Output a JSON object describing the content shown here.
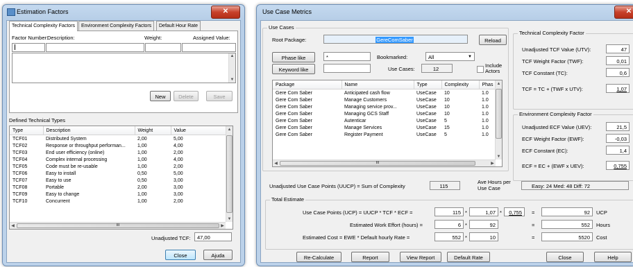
{
  "est": {
    "title": "Estimation Factors",
    "tabs": [
      "Technical Complexity Factors",
      "Environment Complexity Factors",
      "Default Hour Rate"
    ],
    "headers": {
      "number": "Factor Number:",
      "description": "Description:",
      "weight": "Weight:",
      "assigned": "Assigned Value:"
    },
    "buttons": {
      "new": "New",
      "delete": "Delete",
      "save": "Save"
    },
    "defined_label": "Defined Technical Types",
    "columns": [
      "Type",
      "Description",
      "Weight",
      "Value"
    ],
    "rows": [
      [
        "TCF01",
        "Distributed System",
        "2,00",
        "5,00"
      ],
      [
        "TCF02",
        "Response or throughput performan...",
        "1,00",
        "4,00"
      ],
      [
        "TCF03",
        "End user efficiency (online)",
        "1,00",
        "2,00"
      ],
      [
        "TCF04",
        "Complex internal processing",
        "1,00",
        "4,00"
      ],
      [
        "TCF05",
        "Code must be re-usable",
        "1,00",
        "2,00"
      ],
      [
        "TCF06",
        "Easy to install",
        "0,50",
        "5,00"
      ],
      [
        "TCF07",
        "Easy to use",
        "0,50",
        "3,00"
      ],
      [
        "TCF08",
        "Portable",
        "2,00",
        "3,00"
      ],
      [
        "TCF09",
        "Easy to change",
        "1,00",
        "3,00"
      ],
      [
        "TCF10",
        "Concurrent",
        "1,00",
        "2,00"
      ]
    ],
    "hscroll_mark": "III",
    "unadjusted_label": "Unadjusted TCF:",
    "unadjusted_value": "47,00",
    "close": "Close",
    "help": "Ajuda"
  },
  "ucm": {
    "title": "Use Case Metrics",
    "use_cases": {
      "group": "Use Cases",
      "root_label": "Root Package:",
      "root_value": "GereComSaber",
      "reload": "Reload",
      "phase_btn": "Phase like",
      "phase_value": "*",
      "bookmarked_label": "Bookmarked:",
      "bookmarked_value": "All",
      "keyword_btn": "Keyword like",
      "keyword_value": "",
      "usecases_label": "Use Cases:",
      "usecases_count": "12",
      "include_actors": "Include Actors"
    },
    "columns": [
      "Package",
      "Name",
      "Type",
      "Complexity",
      "Phas"
    ],
    "rows": [
      [
        "Gere Com Saber",
        "Anticipated cash flow",
        "UseCase",
        "10",
        "1.0"
      ],
      [
        "Gere Com Saber",
        "Manage Customers",
        "UseCase",
        "10",
        "1.0"
      ],
      [
        "Gere Com Saber",
        "Managing service prov...",
        "UseCase",
        "10",
        "1.0"
      ],
      [
        "Gere Com Saber",
        "Managing GCS Staff",
        "UseCase",
        "10",
        "1.0"
      ],
      [
        "Gere Com Saber",
        "Autenticar",
        "UseCase",
        "5",
        "1.0"
      ],
      [
        "Gere Com Saber",
        "Manage Services",
        "UseCase",
        "15",
        "1.0"
      ],
      [
        "Gere Com Saber",
        "Register Payment",
        "UseCase",
        "5",
        "1.0"
      ]
    ],
    "hscroll_mark": "III",
    "tcf": {
      "group": "Technical Complexity Factor",
      "utv_label": "Unadjusted TCF Value (UTV):",
      "utv": "47",
      "twf_label": "TCF Weight Factor (TWF):",
      "twf": "0,01",
      "tc_label": "TCF Constant (TC):",
      "tc": "0,6",
      "formula": "TCF = TC + (TWF x UTV):",
      "result": "1,07"
    },
    "ecf": {
      "group": "Environment Complexity Factor",
      "uev_label": "Unadjusted ECF Value (UEV):",
      "uev": "21,5",
      "ewf_label": "ECF Weight Factor (EWF):",
      "ewf": "-0,03",
      "ec_label": "ECF Constant (EC):",
      "ec": "1,4",
      "formula": "ECF = EC + (EWF x UEV):",
      "result": "0,755"
    },
    "uucp_label": "Unadjusted Use Case Points (UUCP) = Sum of Complexity",
    "uucp_value": "115",
    "ave_label": "Ave Hours per Use Case",
    "ave_values": "Easy: 24   Med: 48   Diff: 72",
    "total": {
      "group": "Total Estimate",
      "ucp_label": "Use Case Points (UCP) = UUCP * TCF * ECF =",
      "ucp_a": "115",
      "ucp_b": "1,07",
      "ucp_c": "0,755",
      "ucp_result": "92",
      "ucp_unit": "UCP",
      "ewe_label": "Estimated Work Effort (hours) =",
      "ewe_a": "6",
      "ewe_b": "92",
      "ewe_result": "552",
      "ewe_unit": "Hours",
      "cost_label": "Estimated Cost = EWE * Default hourly Rate =",
      "cost_a": "552",
      "cost_b": "10",
      "cost_result": "5520",
      "cost_unit": "Cost",
      "times": "*",
      "equals": "="
    },
    "buttons": {
      "recalc": "Re-Calculate",
      "report": "Report",
      "view": "View Report",
      "rate": "Default Rate",
      "close": "Close",
      "help": "Help"
    }
  }
}
